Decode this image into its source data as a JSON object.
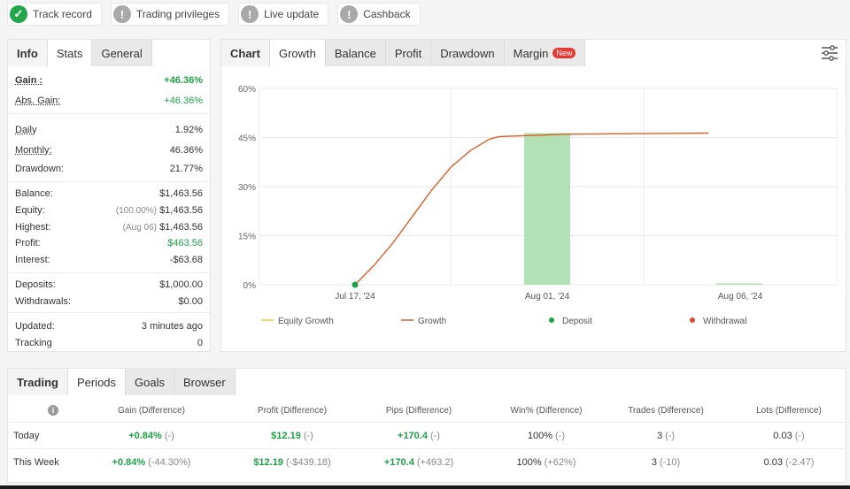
{
  "badges": [
    {
      "label": "Track record",
      "status": "ok"
    },
    {
      "label": "Trading privileges",
      "status": "info"
    },
    {
      "label": "Live update",
      "status": "info"
    },
    {
      "label": "Cashback",
      "status": "info"
    }
  ],
  "stats_panel": {
    "tabs": [
      "Info",
      "Stats",
      "General"
    ],
    "gain_label": "Gain :",
    "gain_value": "+46.36%",
    "abs_gain_label": "Abs. Gain:",
    "abs_gain_value": "+46.36%",
    "daily_label": "Daily",
    "daily_value": "1.92%",
    "monthly_label": "Monthly:",
    "monthly_value": "46.36%",
    "drawdown_label": "Drawdown:",
    "drawdown_value": "21.77%",
    "balance_label": "Balance:",
    "balance_value": "$1,463.56",
    "equity_label": "Equity:",
    "equity_note": "(100.00%)",
    "equity_value": "$1,463.56",
    "highest_label": "Highest:",
    "highest_note": "(Aug 06)",
    "highest_value": "$1,463.56",
    "profit_label": "Profit:",
    "profit_value": "$463.56",
    "interest_label": "Interest:",
    "interest_value": "-$63.68",
    "deposits_label": "Deposits:",
    "deposits_value": "$1,000.00",
    "withdrawals_label": "Withdrawals:",
    "withdrawals_value": "$0.00",
    "updated_label": "Updated:",
    "updated_value": "3 minutes ago",
    "tracking_label": "Tracking",
    "tracking_value": "0"
  },
  "chart_panel": {
    "tabs": [
      "Chart",
      "Growth",
      "Balance",
      "Profit",
      "Drawdown",
      "Margin"
    ],
    "new_badge": "New",
    "settings_icon": "sliders-icon"
  },
  "chart_data": {
    "type": "line",
    "title": "",
    "xlabel": "",
    "ylabel": "",
    "x_ticks": [
      "Jul 17, '24",
      "Aug 01, '24",
      "Aug 06, '24"
    ],
    "y_ticks": [
      "0%",
      "15%",
      "30%",
      "45%",
      "60%"
    ],
    "ylim": [
      0,
      60
    ],
    "grid": true,
    "legend_position": "bottom",
    "legend": [
      "Equity Growth",
      "Growth",
      "Deposit",
      "Withdrawal"
    ],
    "series": [
      {
        "name": "Growth",
        "color": "#d9602b",
        "points": [
          [
            0,
            0
          ],
          [
            0.1,
            6
          ],
          [
            0.2,
            13
          ],
          [
            0.3,
            21
          ],
          [
            0.4,
            29
          ],
          [
            0.5,
            36
          ],
          [
            0.6,
            41
          ],
          [
            0.7,
            44.5
          ],
          [
            0.75,
            45.3
          ],
          [
            0.9,
            45.6
          ],
          [
            1.1,
            46.0
          ],
          [
            1.5,
            46.2
          ],
          [
            1.84,
            46.36
          ]
        ]
      }
    ],
    "bars": [
      {
        "x": 1.0,
        "value": 46.36,
        "color": "#b3e0b5"
      },
      {
        "x": 2.0,
        "value": 0.4,
        "color": "#b3e0b5"
      }
    ],
    "deposit_points": [
      {
        "x": 0,
        "value": 0,
        "color": "#1ea145"
      }
    ],
    "colors": {
      "equity_growth": "#e8c93b",
      "growth": "#d9602b",
      "deposit": "#1ea145",
      "withdrawal": "#e0472b"
    }
  },
  "periods_panel": {
    "tabs": [
      "Trading",
      "Periods",
      "Goals",
      "Browser"
    ],
    "columns": [
      "Gain (Difference)",
      "Profit (Difference)",
      "Pips (Difference)",
      "Win% (Difference)",
      "Trades (Difference)",
      "Lots (Difference)"
    ],
    "rows": [
      {
        "label": "Today",
        "cells": [
          [
            "+0.84%",
            "(-)"
          ],
          [
            "$12.19",
            "(-)"
          ],
          [
            "+170.4",
            "(-)"
          ],
          [
            "100%",
            "(-)"
          ],
          [
            "3",
            "(-)"
          ],
          [
            "0.03",
            "(-)"
          ]
        ]
      },
      {
        "label": "This Week",
        "cells": [
          [
            "+0.84%",
            "(-44.30%)"
          ],
          [
            "$12.19",
            "(-$439.18)"
          ],
          [
            "+170.4",
            "(+493.2)"
          ],
          [
            "100%",
            "(+62%)"
          ],
          [
            "3",
            "(-10)"
          ],
          [
            "0.03",
            "(-2.47)"
          ]
        ]
      }
    ]
  }
}
